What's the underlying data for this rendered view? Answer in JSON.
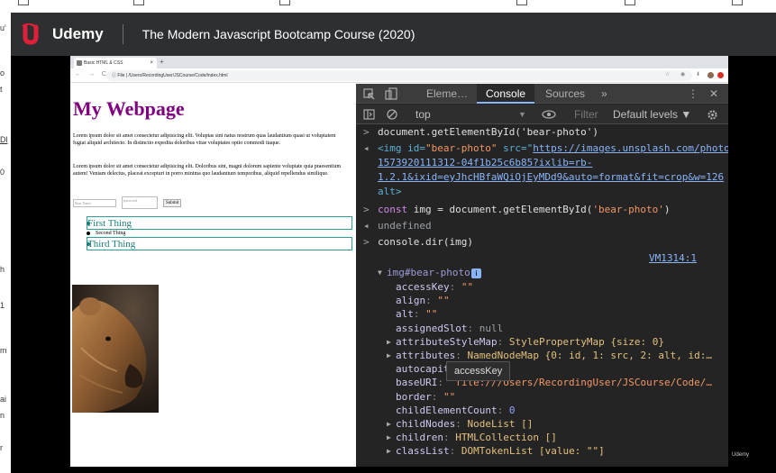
{
  "udemy": {
    "brand": "Udemy",
    "course_title": "The Modern Javascript Bootcamp Course (2020)",
    "watermark": "Udemy"
  },
  "left_page_fragments": [
    "u'",
    "o",
    "t",
    "Dl",
    "0",
    "h",
    "1",
    "m",
    "ai",
    "n",
    "r"
  ],
  "browser": {
    "tab_title": "Basic HTML & CSS",
    "tab_close": "×",
    "new_tab": "+",
    "nav_arrows": "← → C",
    "address": "ⓘ  File  |  /Users/RecordingUser/JSCourse/Code/index.html",
    "nav_icons": "☆ ◉ ⬇"
  },
  "webpage": {
    "heading": "My Webpage",
    "para1": "Lorem ipsum dolor sit amet consectetur adipisicing elit. Voluptas sint natus nostrum quas laudantium quasi ut voluptatem fugiat aliquid architecto. In distinctio expedita doloribus vitae voluptates optio commodi itaque.",
    "para2": "Lorem ipsum dolor sit amet consectetur adipisicing elit. Doloribus sint, magni dolorum sapiente voluptate quia praesentium autem! Veniam delectus, placeat excepturi in porro minima quo laudantium temporibus, aliquid repellendus similique.",
    "bear_name_placeholder": "Bear Name",
    "password_placeholder": "password",
    "submit_label": "Submit",
    "list": [
      "First Thing",
      "Second Thing",
      "Third Thing"
    ]
  },
  "devtools": {
    "tabs": {
      "elements": "Eleme…",
      "console": "Console",
      "sources": "Sources",
      "more": "»",
      "kebab": "⋮",
      "close": "✕"
    },
    "toolbar": {
      "context": "top",
      "filter_placeholder": "Filter",
      "levels": "Default levels ▼"
    },
    "tooltip": "accessKey"
  },
  "console_lines": {
    "l1_cmd": "document.getElementById('bear-photo')",
    "l2_a": "<img id=",
    "l2_b": "\"bear-photo\"",
    "l2_c": " src=\"",
    "l2_url1": "https://images.unsplash.com/photo",
    "l3_url": "1573920111312-04f1b25c6b85?ixlib=rb-",
    "l4_url": "1.2.1&ixid=eyJhcHBfaWQiOjEyMDd9&auto=format&fit=crop&w=126",
    "l5": "alt>",
    "l6_kw": "const",
    "l6_rest": " img = document.getElementById(",
    "l6_str": "'bear-photo'",
    "l6_end": ")",
    "l7": "undefined",
    "l8": "console.dir(img)",
    "vm_link": "VM1314:1",
    "obj_head": "img#bear-photo",
    "props": [
      {
        "k": "accessKey",
        "v": "\"\"",
        "t": "str",
        "arrow": false
      },
      {
        "k": "align",
        "v": "\"\"",
        "t": "str",
        "arrow": false
      },
      {
        "k": "alt",
        "v": "\"\"",
        "t": "str",
        "arrow": false
      },
      {
        "k": "assignedSlot",
        "v": "null",
        "t": "null",
        "arrow": false
      },
      {
        "k": "attributeStyleMap",
        "v": "StylePropertyMap {size: 0}",
        "t": "obj",
        "arrow": true
      },
      {
        "k": "attributes",
        "v": "NamedNodeMap {0: id, 1: src, 2: alt, id:…",
        "t": "obj",
        "arrow": true
      },
      {
        "k": "autocapitalize",
        "v": "\"\"",
        "t": "str",
        "arrow": false
      },
      {
        "k": "baseURI",
        "v": "\"file:///Users/RecordingUser/JSCourse/Code/…",
        "t": "str",
        "arrow": false
      },
      {
        "k": "border",
        "v": "\"\"",
        "t": "str",
        "arrow": false
      },
      {
        "k": "childElementCount",
        "v": "0",
        "t": "num",
        "arrow": false
      },
      {
        "k": "childNodes",
        "v": "NodeList []",
        "t": "obj",
        "arrow": true
      },
      {
        "k": "children",
        "v": "HTMLCollection []",
        "t": "obj",
        "arrow": true
      },
      {
        "k": "classList",
        "v": "DOMTokenList [value: \"\"]",
        "t": "obj",
        "arrow": true
      }
    ]
  }
}
